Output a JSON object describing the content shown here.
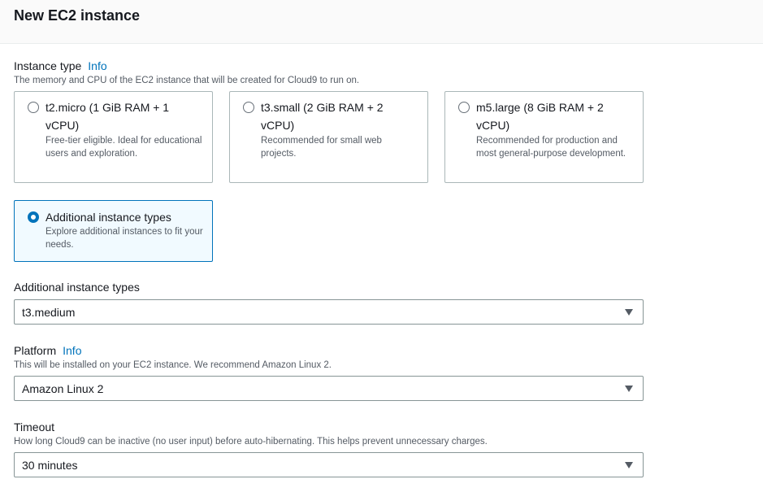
{
  "header": {
    "title": "New EC2 instance"
  },
  "instance_type": {
    "label": "Instance type",
    "info": "Info",
    "description": "The memory and CPU of the EC2 instance that will be created for Cloud9 to run on.",
    "options": [
      {
        "title": "t2.micro (1 GiB RAM + 1 vCPU)",
        "desc": "Free-tier eligible. Ideal for educational users and exploration.",
        "selected": false
      },
      {
        "title": "t3.small (2 GiB RAM + 2 vCPU)",
        "desc": "Recommended for small web projects.",
        "selected": false
      },
      {
        "title": "m5.large (8 GiB RAM + 2 vCPU)",
        "desc": "Recommended for production and most general-purpose development.",
        "selected": false
      },
      {
        "title": "Additional instance types",
        "desc": "Explore additional instances to fit your needs.",
        "selected": true
      }
    ]
  },
  "additional_types": {
    "label": "Additional instance types",
    "value": "t3.medium"
  },
  "platform": {
    "label": "Platform",
    "info": "Info",
    "description": "This will be installed on your EC2 instance. We recommend Amazon Linux 2.",
    "value": "Amazon Linux 2"
  },
  "timeout": {
    "label": "Timeout",
    "description": "How long Cloud9 can be inactive (no user input) before auto-hibernating. This helps prevent unnecessary charges.",
    "value": "30 minutes"
  },
  "colors": {
    "accent": "#0073bb",
    "selected_bg": "#f1faff",
    "border": "#aab7b8",
    "text": "#16191f",
    "muted": "#545b64"
  }
}
